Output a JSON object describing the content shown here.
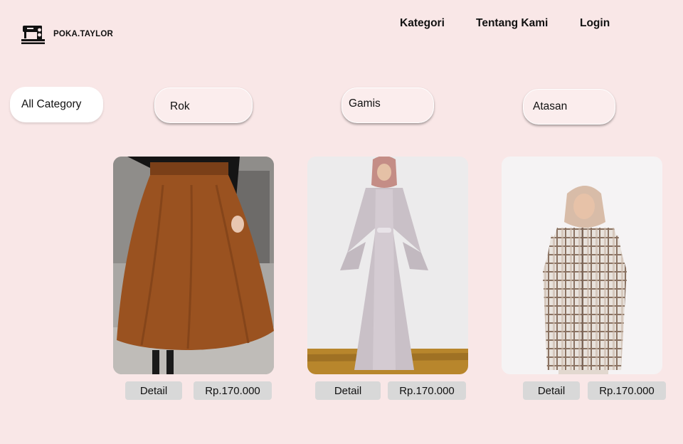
{
  "header": {
    "brand": "POKA.TAYLOR",
    "logo_icon": "sewing-machine-icon",
    "nav": {
      "kategori": "Kategori",
      "tentang_kami": "Tentang Kami",
      "login": "Login"
    }
  },
  "categories": {
    "all": "All Category",
    "rok": "Rok",
    "gamis": "Gamis",
    "atasan": "Atasan"
  },
  "products": [
    {
      "detail_label": "Detail",
      "price": "Rp.170.000"
    },
    {
      "detail_label": "Detail",
      "price": "Rp.170.000"
    },
    {
      "detail_label": "Detail",
      "price": "Rp.170.000"
    }
  ],
  "colors": {
    "background": "#f9e7e7",
    "pill": "#ffffff",
    "chip": "#d8d8d8",
    "text": "#111111"
  }
}
